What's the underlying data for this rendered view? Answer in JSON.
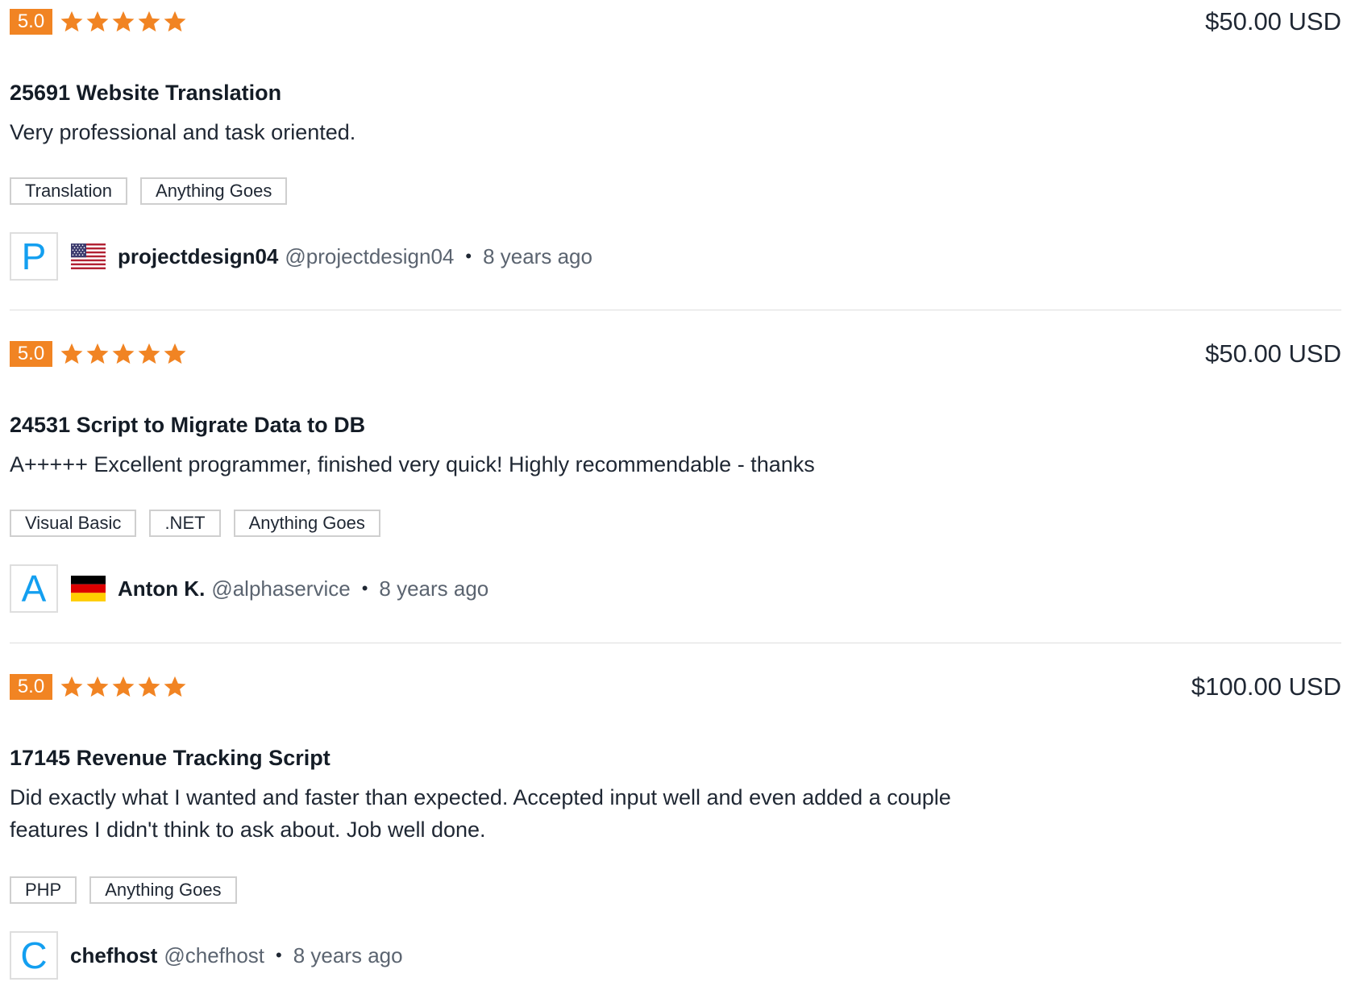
{
  "colors": {
    "rating_badge": "#f18423",
    "star": "#f18423",
    "avatar_letter": "#139ff0"
  },
  "reviews": [
    {
      "rating": "5.0",
      "stars": 5,
      "price": "$50.00 USD",
      "title": "25691 Website Translation",
      "comment": "Very professional and task oriented.",
      "tags": [
        "Translation",
        "Anything Goes"
      ],
      "avatar_letter": "P",
      "flag": "us-flag",
      "username": "projectdesign04",
      "handle": "@projectdesign04",
      "separator": "•",
      "time_ago": "8 years ago"
    },
    {
      "rating": "5.0",
      "stars": 5,
      "price": "$50.00 USD",
      "title": "24531 Script to Migrate Data to DB",
      "comment": "A+++++ Excellent programmer, finished very quick! Highly recommendable - thanks",
      "tags": [
        "Visual Basic",
        ".NET",
        "Anything Goes"
      ],
      "avatar_letter": "A",
      "flag": "germany-flag",
      "username": "Anton K.",
      "handle": "@alphaservice",
      "separator": "•",
      "time_ago": "8 years ago"
    },
    {
      "rating": "5.0",
      "stars": 5,
      "price": "$100.00 USD",
      "title": "17145 Revenue Tracking Script",
      "comment": "Did exactly what I wanted and faster than expected. Accepted input well and even added a couple features I didn't think to ask about. Job well done.",
      "tags": [
        "PHP",
        "Anything Goes"
      ],
      "avatar_letter": "C",
      "flag": "",
      "username": "chefhost",
      "handle": "@chefhost",
      "separator": "•",
      "time_ago": "8 years ago"
    }
  ]
}
